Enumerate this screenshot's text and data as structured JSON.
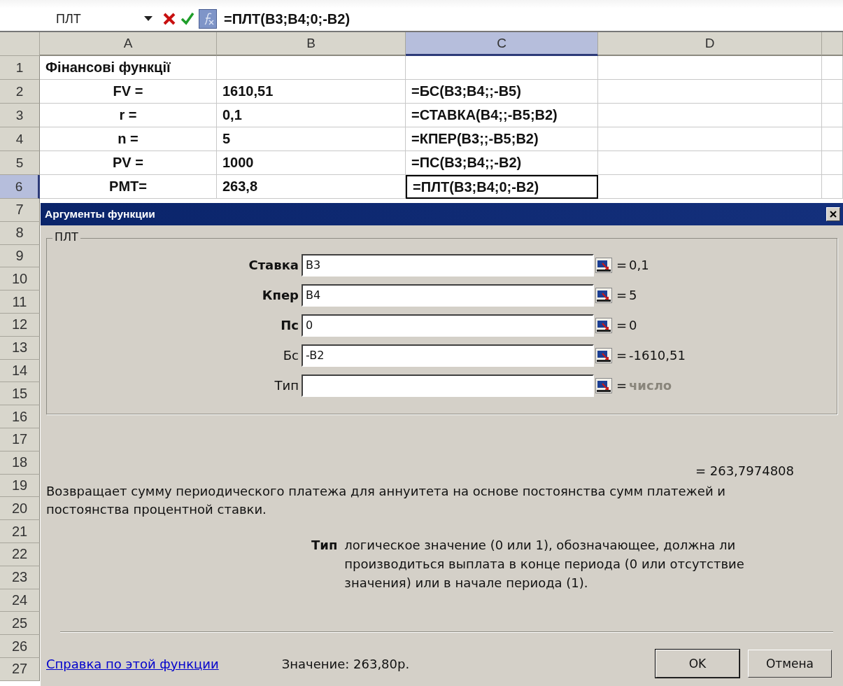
{
  "formula_bar": {
    "name_box": "ПЛТ",
    "formula": "=ПЛТ(B3;B4;0;-B2)"
  },
  "sheet": {
    "columns": [
      {
        "label": "A",
        "selected": false
      },
      {
        "label": "B",
        "selected": false
      },
      {
        "label": "C",
        "selected": true
      },
      {
        "label": "D",
        "selected": false
      }
    ],
    "rows": [
      {
        "header": "1",
        "selected": false,
        "cells": [
          {
            "text": "Фінансові функції",
            "centered": false,
            "selected": false
          },
          {
            "selected": false
          },
          {
            "selected": false
          },
          {
            "selected": false
          }
        ]
      },
      {
        "header": "2",
        "selected": false,
        "cells": [
          {
            "text": "FV =",
            "centered": true,
            "selected": false
          },
          {
            "text": "1610,51",
            "centered": false,
            "selected": false
          },
          {
            "text": "=БС(B3;B4;;-B5)",
            "centered": false,
            "selected": false
          },
          {
            "selected": false
          }
        ]
      },
      {
        "header": "3",
        "selected": false,
        "cells": [
          {
            "text": "r =",
            "centered": true,
            "selected": false
          },
          {
            "text": "0,1",
            "centered": false,
            "selected": false
          },
          {
            "text": "=СТАВКА(B4;;-B5;B2)",
            "centered": false,
            "selected": false
          },
          {
            "selected": false
          }
        ]
      },
      {
        "header": "4",
        "selected": false,
        "cells": [
          {
            "text": "n =",
            "centered": true,
            "selected": false
          },
          {
            "text": "5",
            "centered": false,
            "selected": false
          },
          {
            "text": "=КПЕР(B3;;-B5;B2)",
            "centered": false,
            "selected": false
          },
          {
            "selected": false
          }
        ]
      },
      {
        "header": "5",
        "selected": false,
        "cells": [
          {
            "text": "PV =",
            "centered": true,
            "selected": false
          },
          {
            "text": "1000",
            "centered": false,
            "selected": false
          },
          {
            "text": "=ПС(B3;B4;;-B2)",
            "centered": false,
            "selected": false
          },
          {
            "selected": false
          }
        ]
      },
      {
        "header": "6",
        "selected": true,
        "cells": [
          {
            "text": "PMT=",
            "centered": true,
            "selected": false
          },
          {
            "text": "263,8",
            "centered": false,
            "selected": false
          },
          {
            "text": "=ПЛТ(B3;B4;0;-B2)",
            "centered": false,
            "selected": true
          },
          {
            "selected": false
          }
        ]
      }
    ],
    "covered_row_headers": [
      "7",
      "8",
      "9",
      "10",
      "11",
      "12",
      "13",
      "14",
      "15",
      "16",
      "17",
      "18",
      "19",
      "20",
      "21",
      "22",
      "23",
      "24",
      "25",
      "26",
      "27"
    ]
  },
  "dialog": {
    "title": "Аргументы функции",
    "group_label": "ПЛТ",
    "arguments": [
      {
        "label": "Ставка",
        "required": true,
        "value": "B3",
        "equals": "=",
        "result": "0,1",
        "result_muted": false
      },
      {
        "label": "Кпер",
        "required": true,
        "value": "B4",
        "equals": "=",
        "result": "5",
        "result_muted": false
      },
      {
        "label": "Пс",
        "required": true,
        "value": "0",
        "equals": "=",
        "result": "0",
        "result_muted": false
      },
      {
        "label": "Бс",
        "required": false,
        "value": "-B2",
        "equals": "=",
        "result": "-1610,51",
        "result_muted": false
      },
      {
        "label": "Тип",
        "required": false,
        "equals": "=",
        "result": "число",
        "result_muted": true
      }
    ],
    "formula_result": "= 263,7974808",
    "description": "Возвращает сумму периодического платежа для аннуитета на основе постоянства сумм платежей и постоянства процентной ставки.",
    "argument_help": {
      "label": "Тип",
      "text": "логическое значение (0 или 1), обозначающее, должна ли производиться выплата в конце периода (0 или отсутствие значения) или в начале периода (1)."
    },
    "help_link": "Справка по этой функции",
    "value_text": "Значение: 263,80р.",
    "buttons": [
      "OK",
      "Отмена"
    ]
  }
}
